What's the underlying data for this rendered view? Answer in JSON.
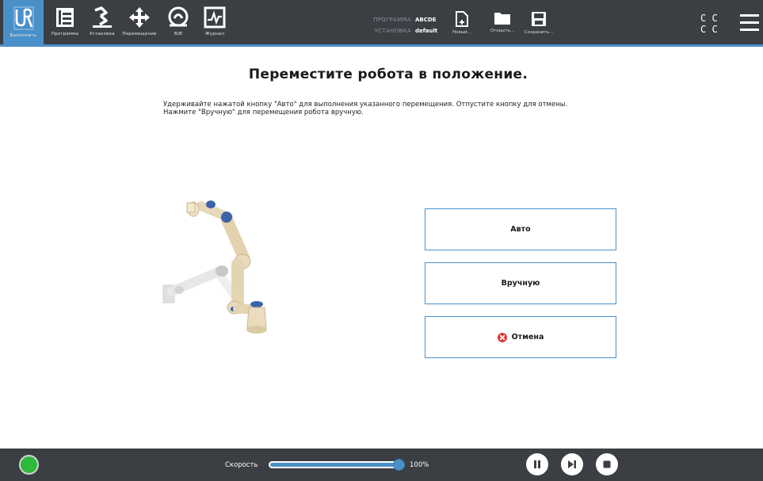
{
  "topbar": {
    "nav": [
      {
        "label": "Выполнить",
        "icon": "ur-logo-icon"
      },
      {
        "label": "Программа",
        "icon": "program-icon"
      },
      {
        "label": "Установка",
        "icon": "installation-icon"
      },
      {
        "label": "Перемещение",
        "icon": "move-icon"
      },
      {
        "label": "В/В",
        "icon": "io-icon"
      },
      {
        "label": "Журнал",
        "icon": "log-icon"
      }
    ],
    "program_key": "ПРОГРАММА",
    "program_value": "ABCDE",
    "installation_key": "УСТАНОВКА",
    "installation_value": "default",
    "file": {
      "new_label": "Новый...",
      "open_label": "Открыть...",
      "save_label": "Сохранить..."
    },
    "cc_top": "C C",
    "cc_bottom": "C C"
  },
  "main": {
    "title": "Переместите робота в положение.",
    "instruction_line1": "Удерживайте нажатой кнопку \"Авто\" для выполнения указанного перемещения. Отпустите кнопку для отмены.",
    "instruction_line2": "Нажмите \"Вручную\" для перемещения робота вручную.",
    "auto_label": "Авто",
    "manual_label": "Вручную",
    "cancel_label": "Отмена"
  },
  "bottombar": {
    "speed_label": "Скорость",
    "speed_value": "100%",
    "speed_fraction": 1.0
  },
  "colors": {
    "accent": "#4a90c8",
    "bar": "#3b3e43",
    "power_on": "#2fb93b",
    "cancel_red": "#e03a3a"
  }
}
